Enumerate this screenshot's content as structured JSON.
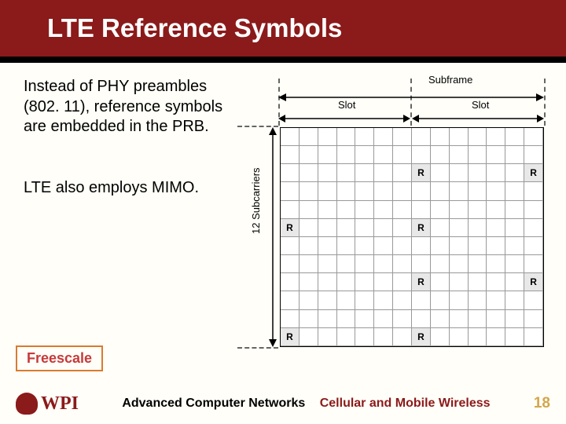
{
  "title": "LTE Reference Symbols",
  "body": {
    "p1": "Instead of PHY preambles (802. 11), reference symbols are embedded in the PRB.",
    "p2": "LTE also employs MIMO."
  },
  "diagram": {
    "subframe": "Subframe",
    "slot": "Slot",
    "subcarriers": "12 Subcarriers",
    "r": "R",
    "r_cells": [
      [
        3,
        8
      ],
      [
        3,
        14
      ],
      [
        6,
        1
      ],
      [
        6,
        8
      ],
      [
        9,
        8
      ],
      [
        9,
        14
      ],
      [
        12,
        1
      ],
      [
        12,
        8
      ]
    ],
    "grid_cols": 14,
    "grid_rows": 12
  },
  "source": "Freescale",
  "footer": {
    "logo_text": "WPI",
    "course": "Advanced Computer Networks",
    "topic": "Cellular and Mobile Wireless",
    "page": "18"
  }
}
